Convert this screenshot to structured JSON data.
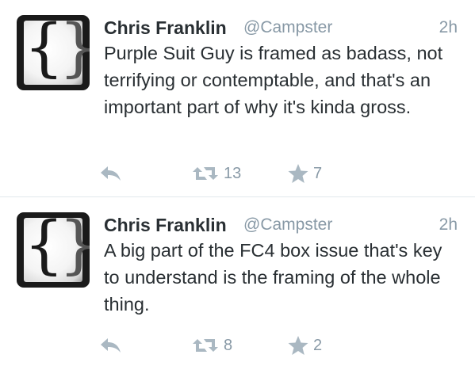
{
  "tweets": [
    {
      "author_name": "Chris Franklin",
      "author_handle": "@Campster",
      "time": "2h",
      "text": "Purple Suit Guy is framed as badass, not terrifying or contemptable, and that's an important part of why it's kinda gross.",
      "retweet_count": "13",
      "favorite_count": "7"
    },
    {
      "author_name": "Chris Franklin",
      "author_handle": "@Campster",
      "time": "2h",
      "text": "A big part of the FC4 box issue that's key to understand is the framing of the whole thing.",
      "retweet_count": "8",
      "favorite_count": "2"
    }
  ],
  "icons": {
    "reply": "reply-icon",
    "retweet": "retweet-icon",
    "favorite": "star-icon"
  },
  "colors": {
    "text": "#292f33",
    "secondary": "#8899a6",
    "icon": "#aab8c2",
    "divider": "#e1e8ed"
  }
}
